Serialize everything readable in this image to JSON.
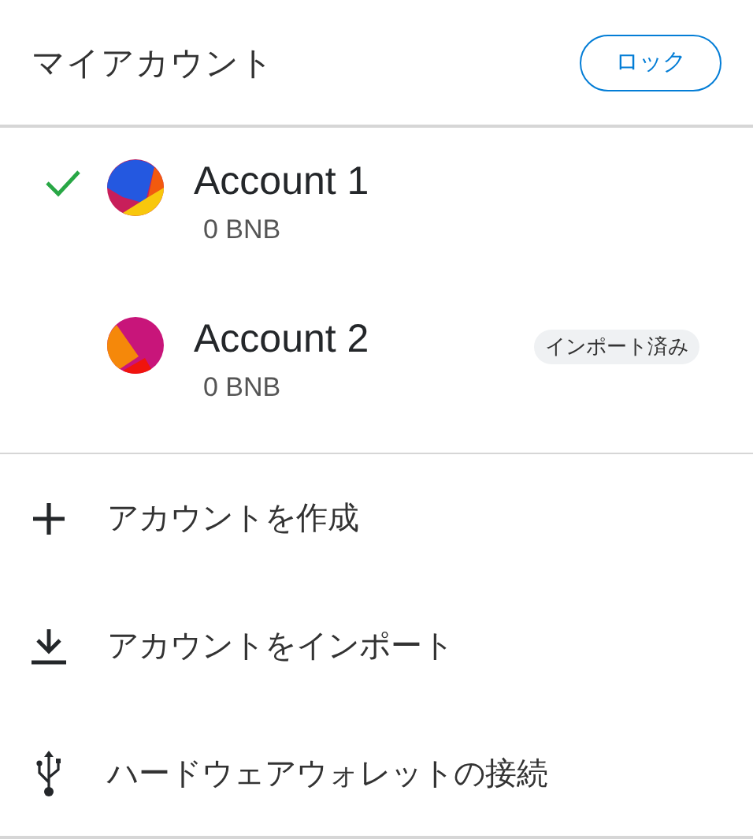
{
  "header": {
    "title": "マイアカウント",
    "lock_button": "ロック"
  },
  "accounts": [
    {
      "name": "Account 1",
      "balance": "0 BNB",
      "selected": true
    },
    {
      "name": "Account 2",
      "balance": "0 BNB",
      "selected": false,
      "badge": "インポート済み"
    }
  ],
  "menu_items": [
    {
      "kind": "create",
      "label": "アカウントを作成"
    },
    {
      "kind": "import",
      "label": "アカウントをインポート"
    },
    {
      "kind": "hardware",
      "label": "ハードウェアウォレットの接続"
    }
  ]
}
